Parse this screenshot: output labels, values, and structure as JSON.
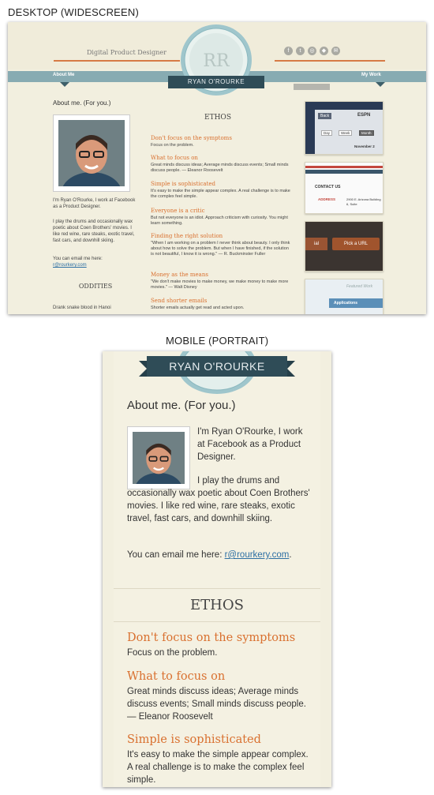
{
  "captions": {
    "desktop": "DESKTOP (WIDESCREEN)",
    "mobile": "MOBILE (PORTRAIT)"
  },
  "colors": {
    "accent": "#d9702f",
    "nav": "#87abb2",
    "ribbon": "#2f4c57",
    "paper": "#f1eedd"
  },
  "desktop": {
    "tagline": "Digital Product Designer",
    "social_icons": [
      "facebook-icon",
      "twitter-icon",
      "dribbble-icon",
      "github-icon",
      "mail-icon"
    ],
    "monogram": "RR",
    "name_ribbon": "RYAN O'ROURKE",
    "nav": {
      "left": "About Me",
      "right": "My Work"
    },
    "about_heading": "About me. (For you.)",
    "bio": [
      "I'm Ryan O'Rourke, I work at Facebook as a Product Designer.",
      "I play the drums and occasionally wax poetic about Coen Brothers' movies. I like red wine, rare steaks, exotic travel, fast cars, and downhill skiing.",
      "You can email me here:"
    ],
    "email": "r@rourkery.com",
    "oddities_heading": "ODDITIES",
    "oddities": [
      "Drank snake blood in Hanoi"
    ],
    "ethos_heading": "ETHOS",
    "ethos": [
      {
        "h": "Don't focus on the symptoms",
        "b": "Focus on the problem."
      },
      {
        "h": "What to focus on",
        "b": "Great minds discuss ideas; Average minds discuss events; Small minds discuss people. — Eleanor Roosevelt"
      },
      {
        "h": "Simple is sophisticated",
        "b": "It's easy to make the simple appear complex. A real challenge is to make the complex feel simple."
      },
      {
        "h": "Everyone is a critic",
        "b": "But not everyone is an idiot. Approach criticism with curiosity. You might learn something."
      },
      {
        "h": "Finding the right solution",
        "b": "\"When I am working on a problem I never think about beauty. I only think about how to solve the problem. But when I have finished, if the solution is not beautiful, I know it is wrong.\" — R. Buckminster Fuller"
      },
      {
        "h": "Money as the means",
        "b": "\"We don't make movies to make money, we make money to make more movies.\" — Walt Disney"
      },
      {
        "h": "Send shorter emails",
        "b": "Shorter emails actually get read and acted upon."
      }
    ],
    "work_thumbs": {
      "espn": {
        "back": "Back",
        "title": "ESPN",
        "tabs": [
          "Day",
          "Week",
          "Month"
        ],
        "date": "November 2"
      },
      "contact": {
        "title": "CONTACT US",
        "label": "ADDRESS",
        "address": "2900 E. Arizona Building 6, Suite"
      },
      "buttons": {
        "left": "ial",
        "right": "Pick a URL"
      },
      "featured": {
        "header": "Featured Work",
        "item": "Applications"
      }
    }
  },
  "mobile": {
    "name_ribbon": "RYAN O'ROURKE",
    "about_heading": "About me. (For you.)",
    "bio_wrapped": "I'm Ryan O'Rourke, I work at Facebook as a Product Designer.",
    "bio_p2": "I play the drums and occasionally wax poetic about Coen Brothers' movies. I like red wine, rare steaks, exotic travel, fast cars, and downhill skiing.",
    "email_prefix": "You can email me here: ",
    "email": "r@rourkery.com",
    "ethos_heading": "ETHOS",
    "ethos": [
      {
        "h": "Don't focus on the symptoms",
        "b": "Focus on the problem."
      },
      {
        "h": "What to focus on",
        "b": "Great minds discuss ideas; Average minds discuss events; Small minds discuss people. — Eleanor Roosevelt"
      },
      {
        "h": "Simple is sophisticated",
        "b": "It's easy to make the simple appear complex. A real challenge is to make the complex feel simple."
      }
    ]
  }
}
